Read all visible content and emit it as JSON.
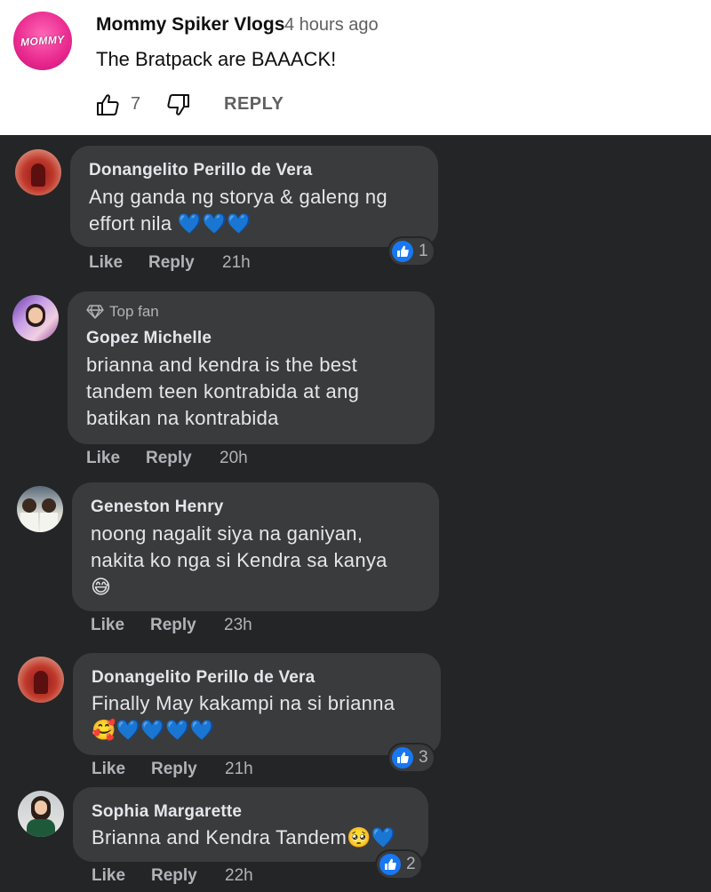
{
  "youtube_comment": {
    "avatar_icon": "mommy-spiker-logo-icon",
    "avatar_text": "MOMMY",
    "author": "Mommy Spiker Vlogs",
    "time": "4 hours ago",
    "text": "The Bratpack are BAAACK!",
    "like_count": "7",
    "reply_label": "REPLY"
  },
  "comments": [
    {
      "author": "Donangelito Perillo de Vera",
      "lines": [
        "Ang ganda ng storya & galeng ng",
        "effort nila"
      ],
      "emojis": "💙💙💙",
      "like": "Like",
      "reply": "Reply",
      "time": "21h",
      "reactions": "1"
    },
    {
      "badge": "Top fan",
      "author": "Gopez Michelle",
      "lines": [
        "brianna and kendra is the best",
        "tandem teen kontrabida at ang",
        "batikan na kontrabida"
      ],
      "like": "Like",
      "reply": "Reply",
      "time": "20h"
    },
    {
      "author": "Geneston Henry",
      "lines": [
        "noong nagalit siya na ganiyan,",
        "nakita ko nga si Kendra sa kanya"
      ],
      "emojis": "😅",
      "like": "Like",
      "reply": "Reply",
      "time": "23h"
    },
    {
      "author": "Donangelito Perillo de Vera",
      "lines": [
        "Finally May kakampi na si brianna"
      ],
      "emojis": "🥰💙💙💙💙",
      "like": "Like",
      "reply": "Reply",
      "time": "21h",
      "reactions": "3"
    },
    {
      "author": "Sophia Margarette",
      "lines": [
        "Brianna and Kendra Tandem"
      ],
      "emojis": "🥺💙",
      "like": "Like",
      "reply": "Reply",
      "time": "22h",
      "reactions": "2"
    }
  ],
  "colors": {
    "background": "#242526",
    "bubble": "#3a3b3c",
    "text": "#e4e6eb",
    "muted": "#b0b3b8",
    "like_blue": "#1877f2",
    "heart_blue": "#5bc0f7"
  }
}
